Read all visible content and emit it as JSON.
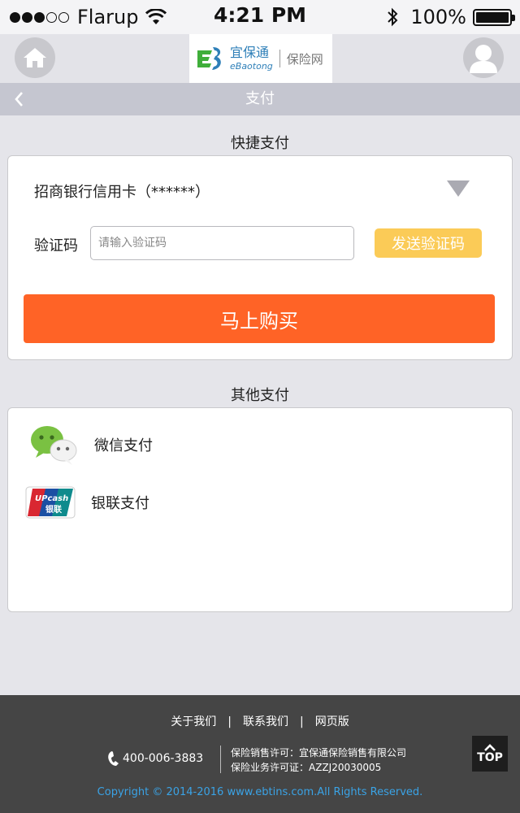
{
  "status_bar": {
    "carrier": "Flarup",
    "time": "4:21 PM",
    "battery_pct": "100%",
    "battery_level": 1.0,
    "signal_bars_filled": 3,
    "signal_bars_total": 5
  },
  "header": {
    "logo_cn": "宜保通",
    "logo_en": "eBaotong",
    "logo_sub": "保险网",
    "home_icon": "home-icon",
    "user_icon": "user-icon"
  },
  "titlebar": {
    "title": "支付",
    "back_icon": "chevron-left-icon"
  },
  "quick_pay": {
    "section_label": "快捷支付",
    "bank_label": "招商银行信用卡（******）",
    "code_label": "验证码",
    "code_placeholder": "请输入验证码",
    "code_value": "",
    "send_code_label": "发送验证码",
    "buy_label": "马上购买"
  },
  "other_pay": {
    "section_label": "其他支付",
    "methods": [
      {
        "label": "微信支付",
        "icon": "wechat-icon"
      },
      {
        "label": "银联支付",
        "icon": "unionpay-icon"
      }
    ]
  },
  "footer": {
    "links": [
      "关于我们",
      "联系我们",
      "网页版"
    ],
    "phone": "400-006-3883",
    "license_1": "保险销售许可：宜保通保险销售有限公司",
    "license_2": "保险业务许可证：AZZJ20030005",
    "top_label": "TOP",
    "copyright": "Copyright © 2014-2016 www.ebtins.com.All Rights Reserved."
  },
  "colors": {
    "accent": "#ff6326",
    "send_button": "#fbcb57",
    "titlebar": "#c5c6d0",
    "footer": "#454545",
    "copyright": "#3aa3e6"
  }
}
